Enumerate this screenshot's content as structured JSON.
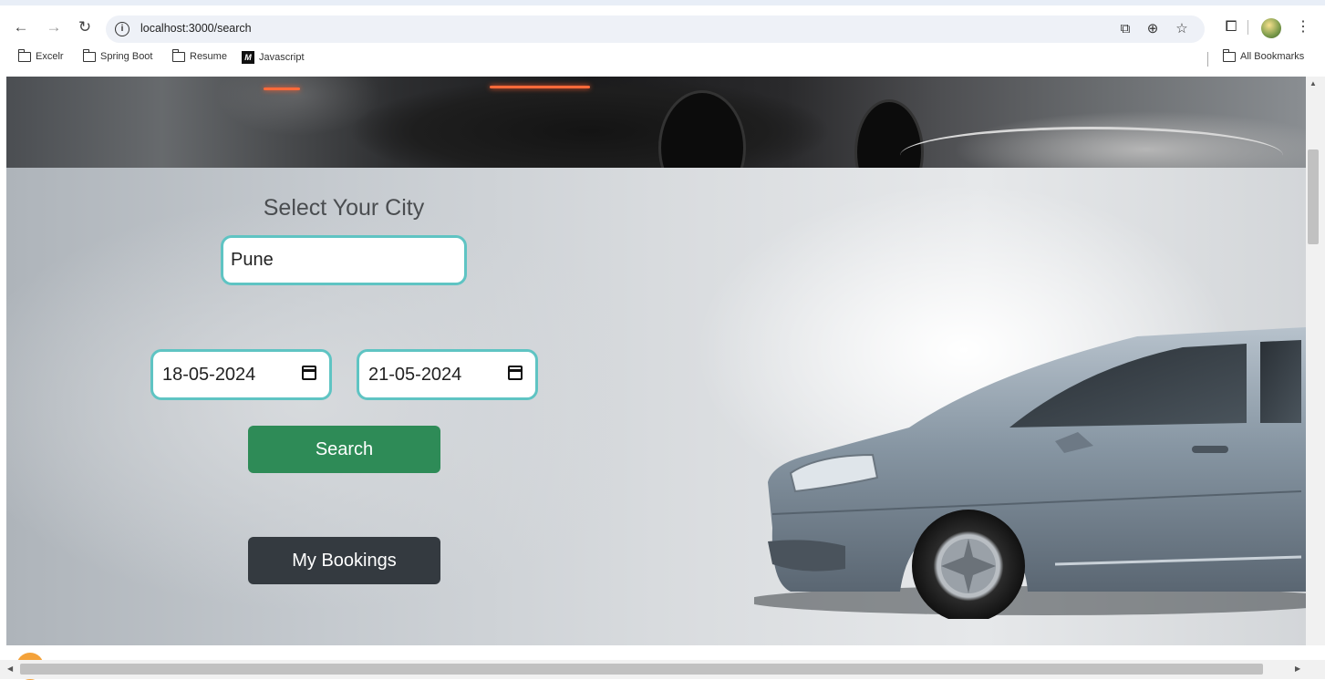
{
  "browser": {
    "url": "localhost:3000/search",
    "bookmarks": [
      "Excelr",
      "Spring Boot",
      "Resume",
      "Javascript"
    ],
    "bookmarks_right": "All Bookmarks",
    "javascript_logo": "M"
  },
  "form": {
    "title": "Select Your City",
    "city_value": "Pune",
    "date_from": "18-05-2024",
    "date_to": "21-05-2024",
    "search_label": "Search",
    "bookings_label": "My Bookings"
  },
  "colors": {
    "field_border": "#5fc4c3",
    "search_button": "#2e8b57",
    "bookings_button": "#343a40"
  }
}
